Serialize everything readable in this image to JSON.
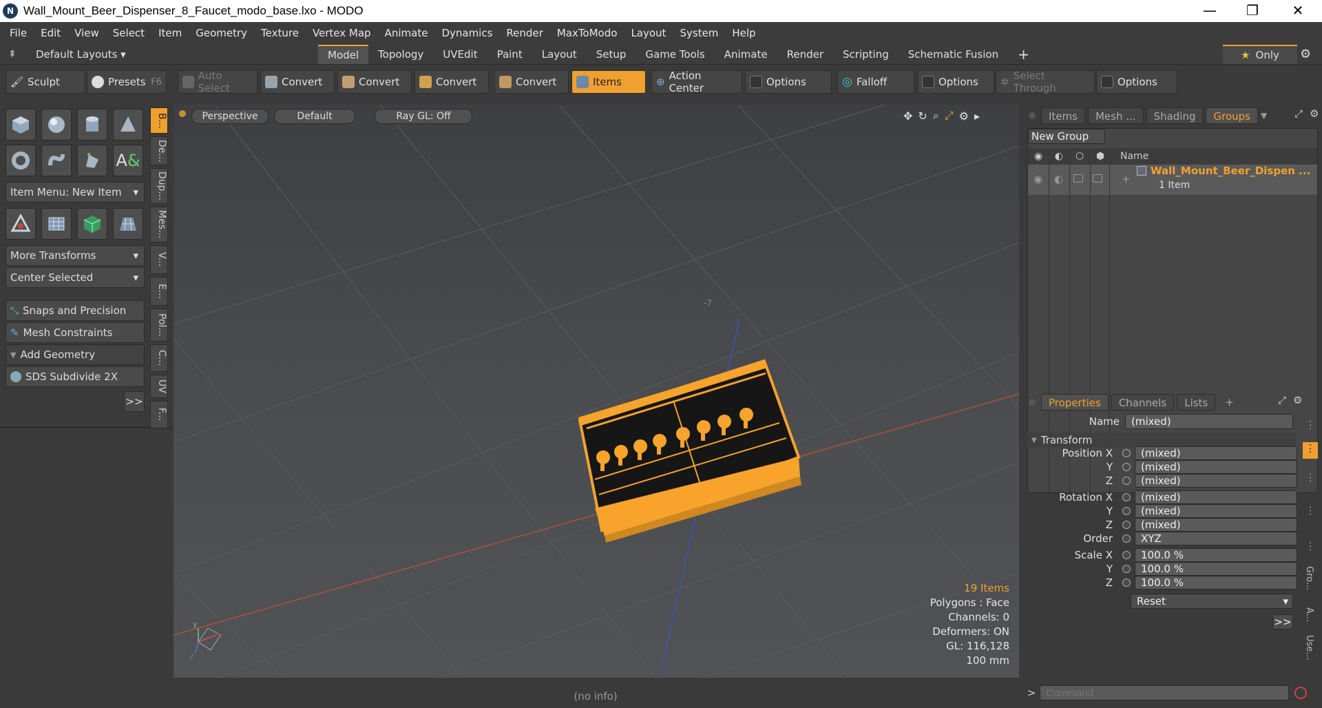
{
  "window": {
    "title": "Wall_Mount_Beer_Dispenser_8_Faucet_modo_base.lxo - MODO",
    "logo": "N",
    "controls": [
      "—",
      "❐",
      "✕"
    ]
  },
  "menu": [
    "File",
    "Edit",
    "View",
    "Select",
    "Item",
    "Geometry",
    "Texture",
    "Vertex Map",
    "Animate",
    "Dynamics",
    "Render",
    "MaxToModo",
    "Layout",
    "System",
    "Help"
  ],
  "layoutbar": {
    "layouts_label": "Default Layouts",
    "tabs": [
      "Model",
      "Topology",
      "UVEdit",
      "Paint",
      "Layout",
      "Setup",
      "Game Tools",
      "Animate",
      "Render",
      "Scripting",
      "Schematic Fusion"
    ],
    "active_tab": "Model",
    "add": "+",
    "only_label": "Only",
    "star": "★"
  },
  "toolbar": {
    "sculpt": "Sculpt",
    "presets": "Presets",
    "presets_key": "F6",
    "auto_select": "Auto Select",
    "convert": "Convert",
    "items": "Items",
    "action_center": "Action Center",
    "options": "Options",
    "falloff": "Falloff",
    "select_through": "Select Through"
  },
  "leftpanel": {
    "item_menu": "Item Menu: New Item",
    "more_transforms": "More Transforms",
    "center_selected": "Center Selected",
    "snaps": "Snaps and Precision",
    "mesh_constraints": "Mesh Constraints",
    "add_geometry": "Add Geometry",
    "sds": "SDS Subdivide 2X",
    "more": ">>",
    "vtabs": [
      "B...",
      "De...",
      "Dup...",
      "Mes...",
      "V...",
      "E...",
      "Pol...",
      "C...",
      "UV",
      "F..."
    ]
  },
  "viewport": {
    "view": "Perspective",
    "shading": "Default",
    "raygl": "Ray GL: Off",
    "stats": {
      "items": "19 Items",
      "polygons": "Polygons : Face",
      "channels": "Channels: 0",
      "deformers": "Deformers: ON",
      "gl": "GL: 116,128",
      "scale": "100 mm"
    },
    "axis_label": "-7"
  },
  "groups_panel": {
    "tabs": [
      "Items",
      "Mesh ...",
      "Shading",
      "Groups"
    ],
    "active": "Groups",
    "new_group": "New Group",
    "col_name": "Name",
    "group_name": "Wall_Mount_Beer_Dispen ...",
    "group_count": "1 Item"
  },
  "properties": {
    "tabs": [
      "Properties",
      "Channels",
      "Lists"
    ],
    "add": "+",
    "name_label": "Name",
    "name_value": "(mixed)",
    "section": "Transform",
    "rows": [
      {
        "label": "Position X",
        "value": "(mixed)"
      },
      {
        "label": "Y",
        "value": "(mixed)"
      },
      {
        "label": "Z",
        "value": "(mixed)"
      },
      {
        "label": "Rotation X",
        "value": "(mixed)"
      },
      {
        "label": "Y",
        "value": "(mixed)"
      },
      {
        "label": "Z",
        "value": "(mixed)"
      },
      {
        "label": "Order",
        "value": "XYZ"
      },
      {
        "label": "Scale X",
        "value": "100.0 %"
      },
      {
        "label": "Y",
        "value": "100.0 %"
      },
      {
        "label": "Z",
        "value": "100.0 %"
      }
    ],
    "reset": "Reset",
    "more": ">>",
    "side_tabs": [
      "Gro...",
      "A...",
      "Use..."
    ]
  },
  "command": {
    "prompt": ">",
    "placeholder": "Command"
  },
  "status": "(no info)",
  "colors": {
    "accent": "#f0a030",
    "selection": "#f7a32c"
  }
}
